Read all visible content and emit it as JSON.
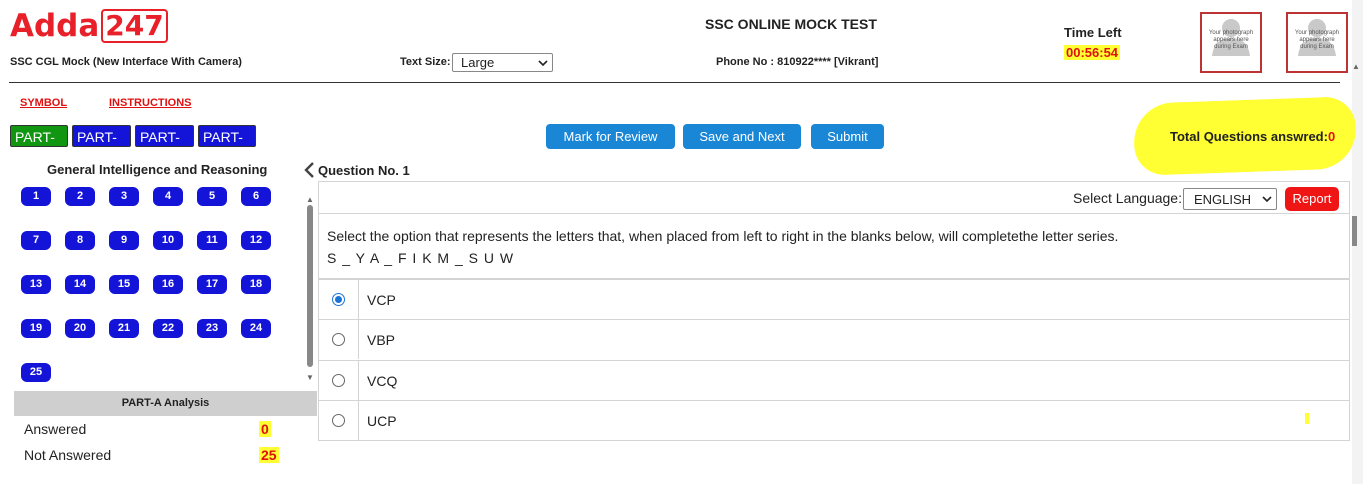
{
  "header": {
    "logo_text": "Adda",
    "logo_number": "247",
    "mock_name": "SSC CGL Mock (New Interface With Camera)",
    "text_size_label": "Text Size:",
    "text_size_value": "Large",
    "test_title": "SSC ONLINE MOCK TEST",
    "phone": "Phone No : 810922**** [Vikrant]",
    "time_left_label": "Time Left",
    "time_left_value": "00:56:54",
    "photo_caption": "Your photograph appears here during Exam"
  },
  "links": {
    "symbol": "SYMBOL",
    "instructions": "INSTRUCTIONS"
  },
  "parts": [
    "PART-A",
    "PART-B",
    "PART-C",
    "PART-D"
  ],
  "actions": {
    "mark_review": "Mark for Review",
    "save_next": "Save and Next",
    "submit": "Submit"
  },
  "total_answered": {
    "label": "Total Questions answred:",
    "value": "0"
  },
  "palette": {
    "section_title": "General Intelligence and Reasoning",
    "questions": [
      "1",
      "2",
      "3",
      "4",
      "5",
      "6",
      "7",
      "8",
      "9",
      "10",
      "11",
      "12",
      "13",
      "14",
      "15",
      "16",
      "17",
      "18",
      "19",
      "20",
      "21",
      "22",
      "23",
      "24",
      "25"
    ]
  },
  "analysis": {
    "header": "PART-A Analysis",
    "answered_label": "Answered",
    "answered_value": "0",
    "not_answered_label": "Not Answered",
    "not_answered_value": "25"
  },
  "question": {
    "number_label": "Question No. 1",
    "select_language_label": "Select Language:",
    "language": "ENGLISH",
    "report_label": "Report",
    "text": "Select the option that represents the letters that, when placed from left to right in the blanks below, will completethe letter series.",
    "series": "S _ Y A _ F I K M _ S U W",
    "options": [
      {
        "label": "VCP",
        "selected": true
      },
      {
        "label": "VBP",
        "selected": false
      },
      {
        "label": "VCQ",
        "selected": false
      },
      {
        "label": "UCP",
        "selected": false
      }
    ]
  },
  "colors": {
    "brand_red": "#e8202a",
    "part_active": "#119611",
    "part_inactive": "#1414d8",
    "action_blue": "#1a86d6",
    "highlight_yellow": "#ffff33",
    "report_red": "#f01515"
  }
}
